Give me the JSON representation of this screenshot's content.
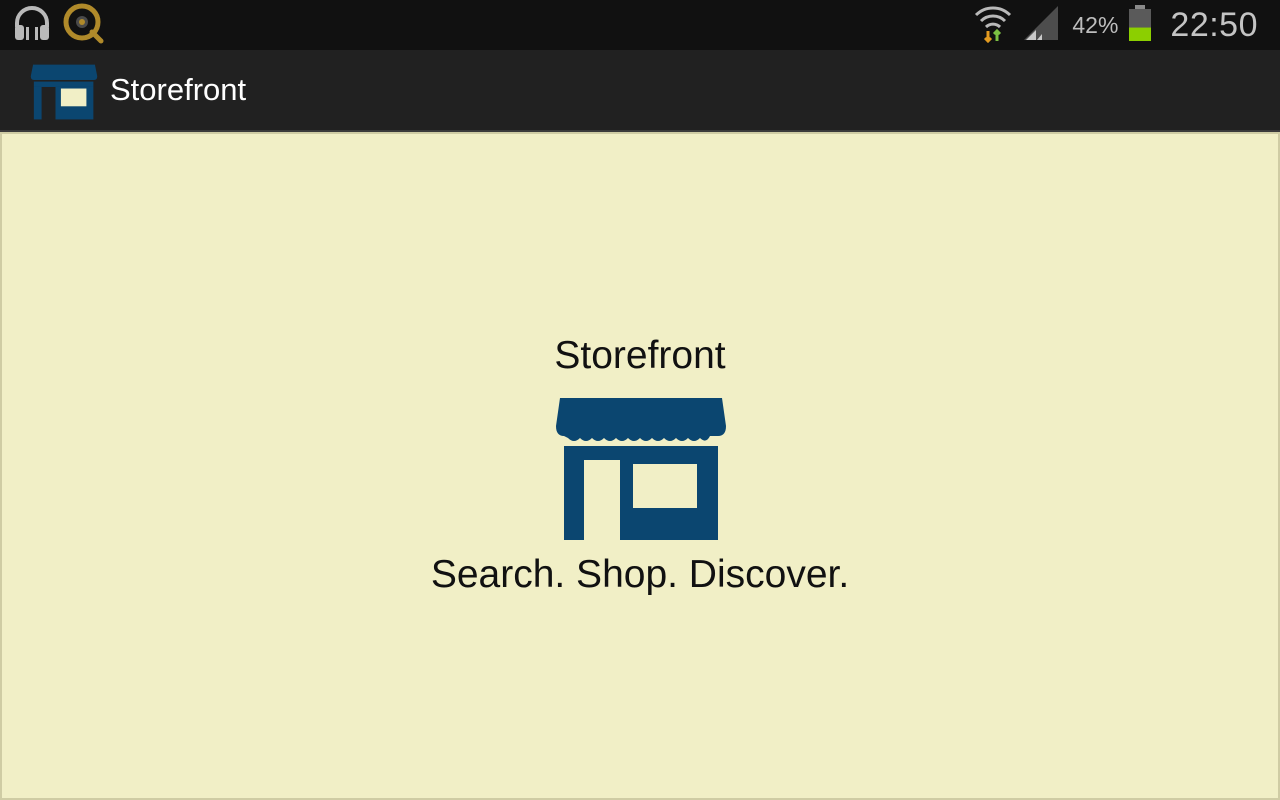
{
  "status_bar": {
    "left_icons": [
      "headphones-icon",
      "qik-camera-icon"
    ],
    "right_icons": [
      "wifi-data-icon",
      "signal-icon",
      "battery-icon"
    ],
    "battery_percent": "42%",
    "battery_level": 0.42,
    "time": "22:50"
  },
  "action_bar": {
    "title": "Storefront",
    "icon": "storefront-icon"
  },
  "splash": {
    "title": "Storefront",
    "icon": "storefront-icon",
    "tagline": "Search. Shop. Discover."
  },
  "colors": {
    "status_bar_bg": "#111111",
    "action_bar_bg": "#212121",
    "content_bg": "#f1efc6",
    "brand_blue": "#0b4670",
    "battery_green": "#8ccf00"
  }
}
